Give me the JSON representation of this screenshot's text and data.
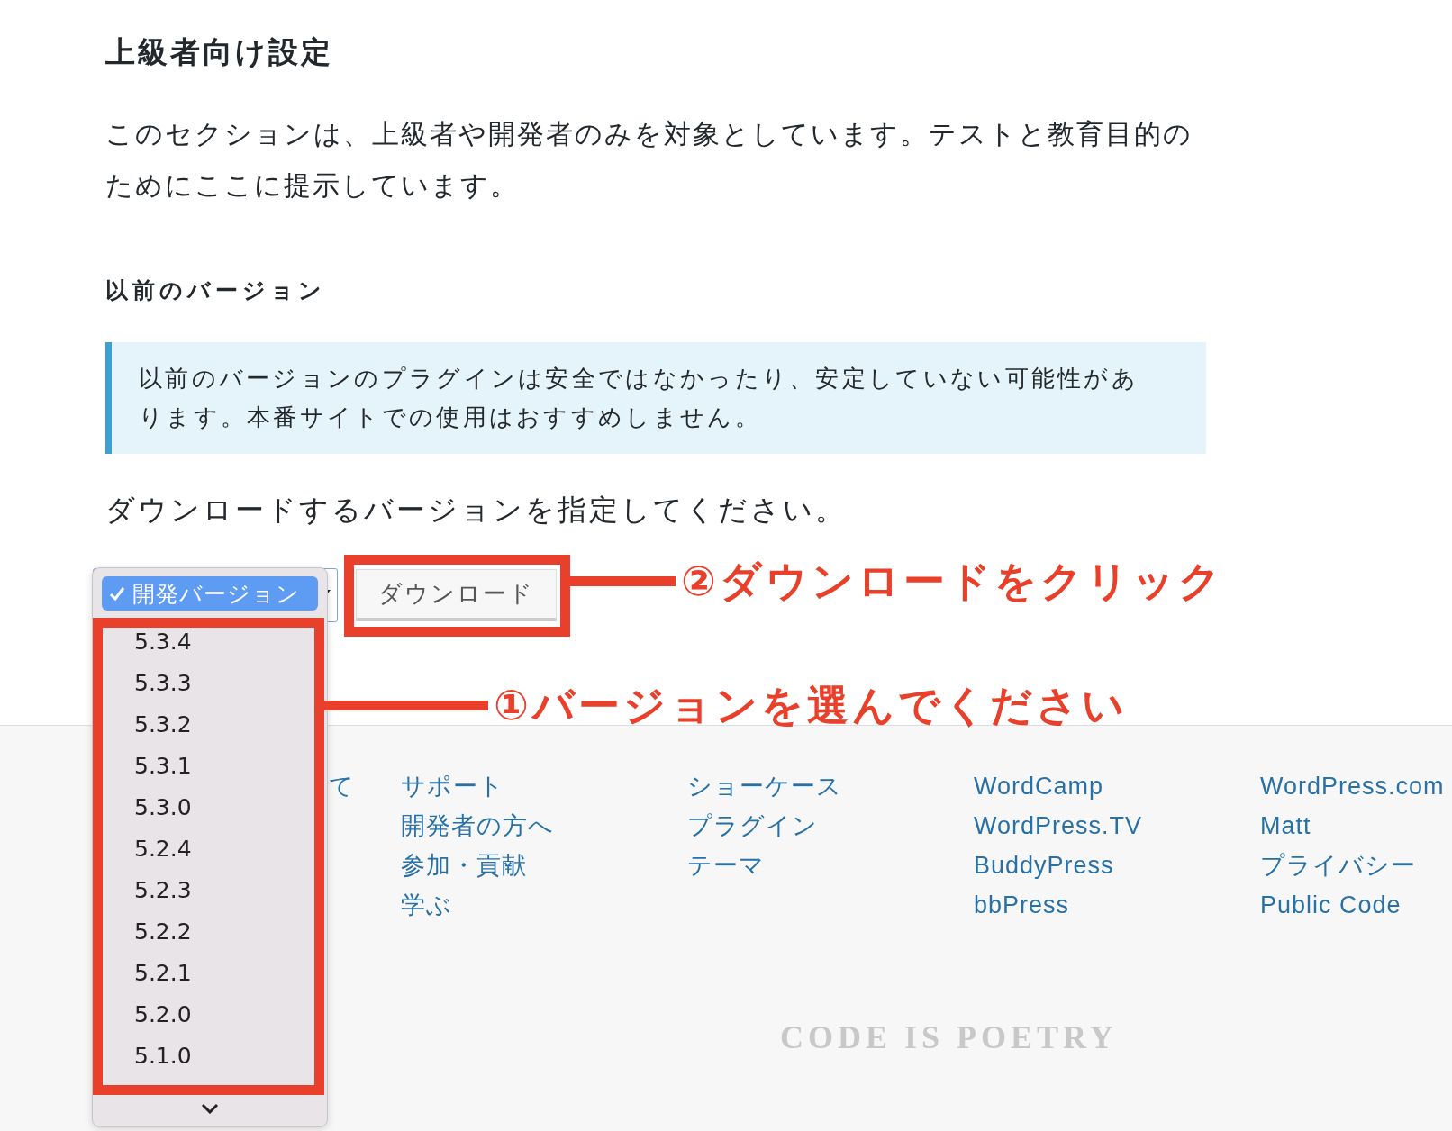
{
  "heading": "上級者向け設定",
  "intro": "このセクションは、上級者や開発者のみを対象としています。テストと教育目的のためにここに提示しています。",
  "section_heading": "以前のバージョン",
  "notice": "以前のバージョンのプラグインは安全ではなかったり、安定していない可能性があります。本番サイトでの使用はおすすめしません。",
  "instruction": "ダウンロードするバージョンを指定してください。",
  "version_select": {
    "open": true,
    "options": [
      {
        "label": "開発バージョン",
        "selected": true
      },
      {
        "label": "5.3.4",
        "selected": false
      },
      {
        "label": "5.3.3",
        "selected": false
      },
      {
        "label": "5.3.2",
        "selected": false
      },
      {
        "label": "5.3.1",
        "selected": false
      },
      {
        "label": "5.3.0",
        "selected": false
      },
      {
        "label": "5.2.4",
        "selected": false
      },
      {
        "label": "5.2.3",
        "selected": false
      },
      {
        "label": "5.2.2",
        "selected": false
      },
      {
        "label": "5.2.1",
        "selected": false
      },
      {
        "label": "5.2.0",
        "selected": false
      },
      {
        "label": "5.1.0",
        "selected": false
      }
    ]
  },
  "download_button": "ダウンロード",
  "footer": {
    "columns": [
      [
        "て"
      ],
      [
        "サポート",
        "開発者の方へ",
        "参加・貢献",
        "学ぶ"
      ],
      [
        "ショーケース",
        "プラグイン",
        "テーマ"
      ],
      [
        "WordCamp",
        "WordPress.TV",
        "BuddyPress",
        "bbPress"
      ],
      [
        "WordPress.com",
        "Matt",
        "プライバシー",
        "Public Code"
      ]
    ],
    "tagline": "CODE IS POETRY"
  },
  "annotations": [
    {
      "kind": "button",
      "text": "②ダウンロードをクリック"
    },
    {
      "kind": "list",
      "text": "①バージョンを選んでください"
    }
  ]
}
